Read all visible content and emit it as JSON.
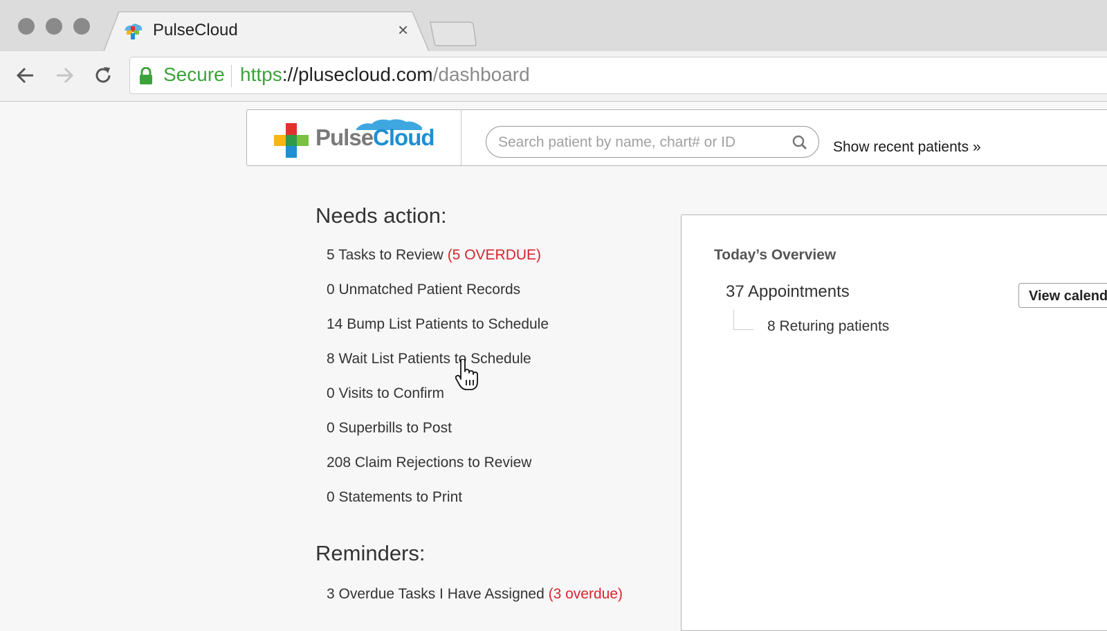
{
  "browser": {
    "tab_title": "PulseCloud",
    "tab_close": "×",
    "secure_label": "Secure",
    "url_scheme": "https",
    "url_host": "://plusecloud.com",
    "url_path": "/dashboard"
  },
  "header": {
    "logo_text_1": "Pulse",
    "logo_text_2": "Cloud",
    "search_placeholder": "Search patient by name, chart# or ID",
    "recent_link": "Show recent patients »"
  },
  "needs_action": {
    "title": "Needs action:",
    "items": [
      {
        "label": "5 Tasks to Review ",
        "overdue": "(5 OVERDUE)"
      },
      {
        "label": "0 Unmatched Patient Records"
      },
      {
        "label": "14 Bump List Patients to Schedule"
      },
      {
        "label": "8 Wait List Patients to Schedule"
      },
      {
        "label": "0 Visits to Confirm"
      },
      {
        "label": "0 Superbills to Post"
      },
      {
        "label": "208 Claim Rejections to Review"
      },
      {
        "label": "0 Statements to Print"
      }
    ]
  },
  "reminders": {
    "title": "Reminders:",
    "items": [
      {
        "label": "3 Overdue Tasks I Have Assigned ",
        "overdue": "(3 overdue)"
      }
    ]
  },
  "overview": {
    "title": "Today’s Overview",
    "appointments": "37 Appointments",
    "returning": "8 Returing patients",
    "view_calendar": "View calendar"
  },
  "colors": {
    "secure_green": "#3ca33a",
    "overdue_red": "#d9232e",
    "brand_blue": "#1f8fd1"
  }
}
